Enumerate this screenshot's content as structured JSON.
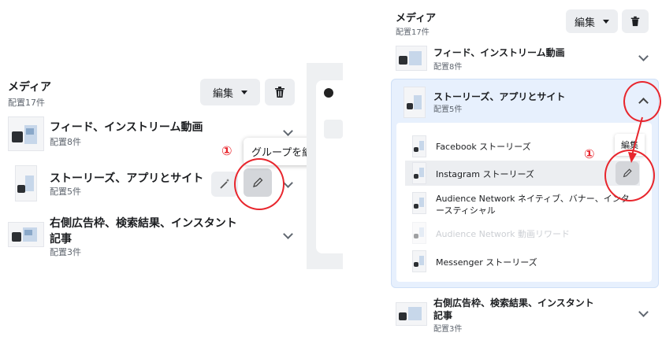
{
  "left": {
    "media_title": "メディア",
    "media_sub": "配置17件",
    "edit_label": "編集",
    "rows": [
      {
        "title": "フィード、インストリーム動画",
        "sub": "配置8件"
      },
      {
        "title": "ストーリーズ、アプリとサイト",
        "sub": "配置5件"
      },
      {
        "title": "右側広告枠、検索結果、インスタント",
        "title2": "記事",
        "sub": "配置3件"
      }
    ],
    "tooltip": "グループを編集",
    "marker": "①"
  },
  "right": {
    "media_title": "メディア",
    "media_sub": "配置17件",
    "edit_label": "編集",
    "rows": [
      {
        "title": "フィード、インストリーム動画",
        "sub": "配置8件"
      },
      {
        "title": "ストーリーズ、アプリとサイト",
        "sub": "配置5件"
      },
      {
        "title": "右側広告枠、検索結果、インスタント",
        "title2": "記事",
        "sub": "配置3件"
      }
    ],
    "subitems": [
      {
        "label": "Facebook ストーリーズ"
      },
      {
        "label": "Instagram ストーリーズ"
      },
      {
        "label": "Audience Network ネイティブ、バナー、インタ",
        "label2": "ースティシャル"
      },
      {
        "label": "Audience Network 動画リワード"
      },
      {
        "label": "Messenger ストーリーズ"
      }
    ],
    "partial_edit": "編集",
    "marker": "①"
  },
  "colors": {
    "accent_red": "#e8262d",
    "selected_bg": "#e7f0fd",
    "selected_border": "#cfe0f7"
  },
  "icons": [
    "trash-icon",
    "caret-down-icon",
    "chevron-down-icon",
    "chevron-up-icon",
    "pencil-icon",
    "magic-wand-icon"
  ]
}
